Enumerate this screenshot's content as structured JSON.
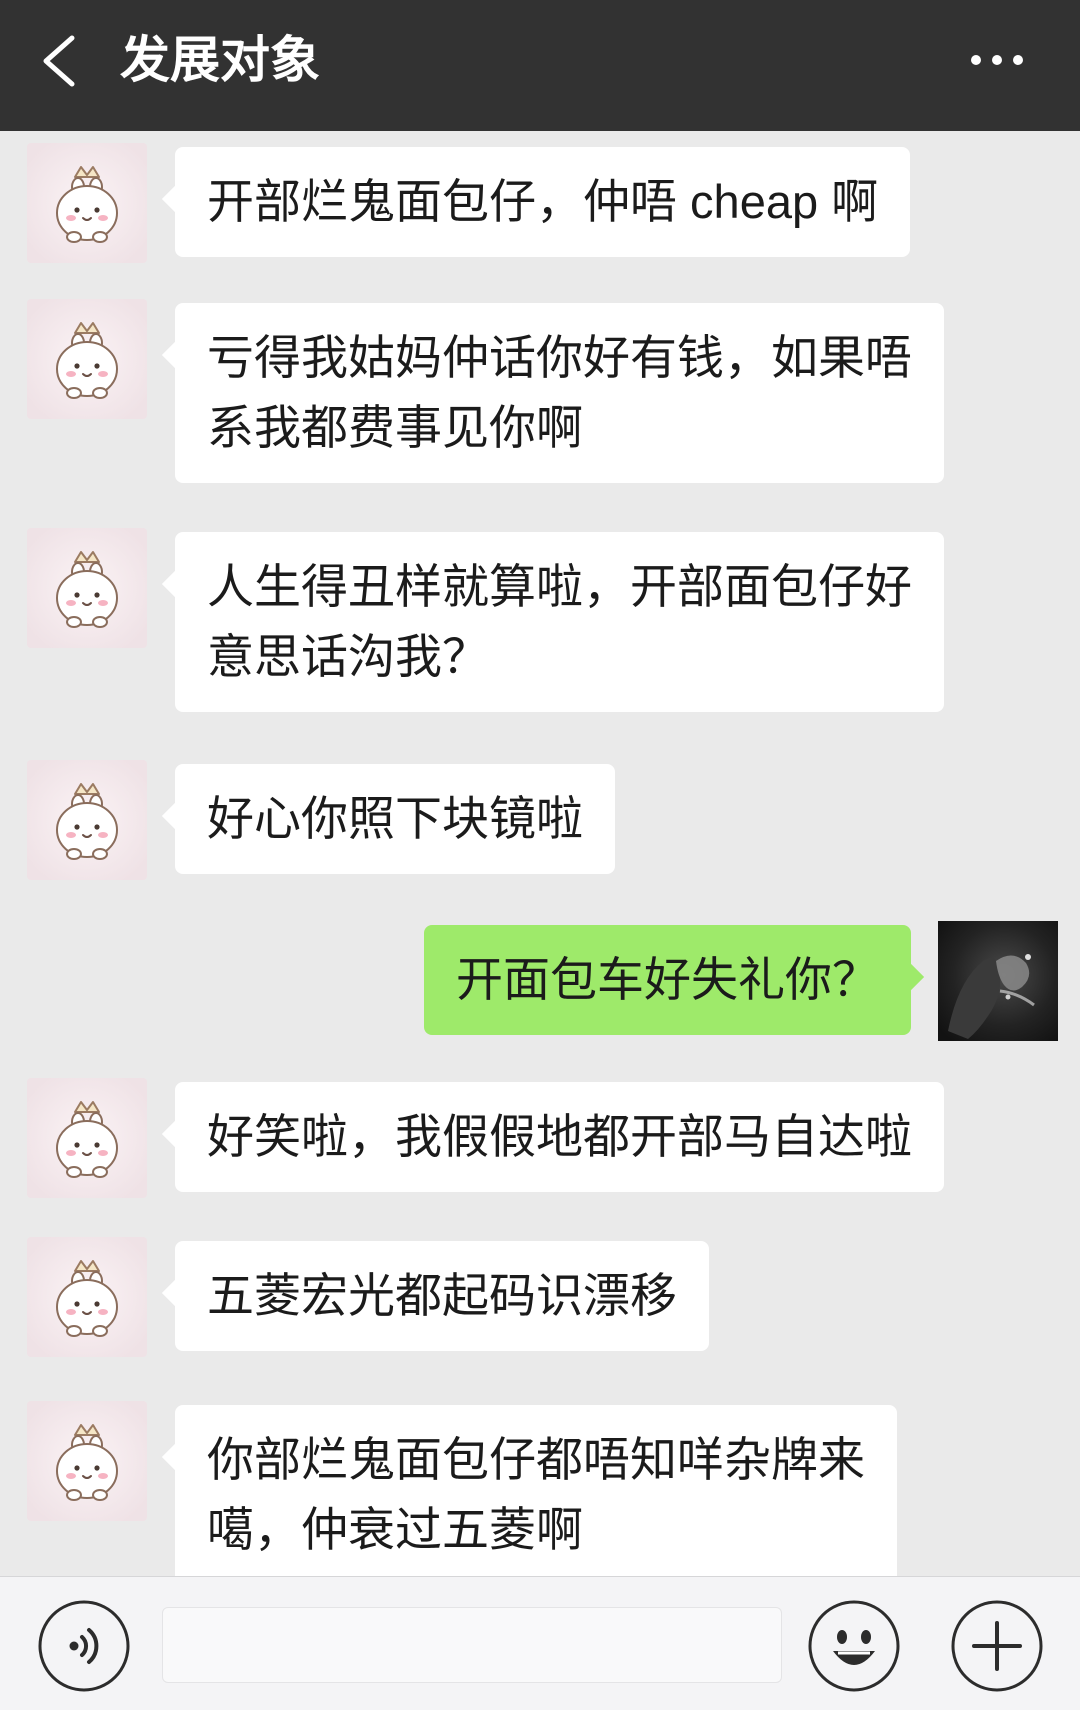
{
  "header": {
    "title": "发展对象",
    "back_icon": "chevron-left-icon",
    "more_icon": "more-horizontal-icon"
  },
  "colors": {
    "header_background": "#323232",
    "chat_background": "#eaeaea",
    "incoming_bubble": "#ffffff",
    "outgoing_bubble": "#9eea6a",
    "input_bar_background": "#f4f4f6"
  },
  "avatars": {
    "contact_icon": "bunny-avatar-icon",
    "self_icon": "photo-avatar-icon"
  },
  "messages": [
    {
      "outgoing": false,
      "lines": [
        "开部烂鬼面包仔，仲唔 cheap 啊"
      ]
    },
    {
      "outgoing": false,
      "lines": [
        "亏得我姑妈仲话你好有钱，如果唔",
        "系我都费事见你啊"
      ]
    },
    {
      "outgoing": false,
      "lines": [
        "人生得丑样就算啦，开部面包仔好",
        "意思话沟我？"
      ]
    },
    {
      "outgoing": false,
      "lines": [
        "好心你照下块镜啦"
      ]
    },
    {
      "outgoing": true,
      "lines": [
        "开面包车好失礼你？"
      ]
    },
    {
      "outgoing": false,
      "lines": [
        "好笑啦，我假假地都开部马自达啦"
      ]
    },
    {
      "outgoing": false,
      "lines": [
        "五菱宏光都起码识漂移"
      ]
    },
    {
      "outgoing": false,
      "lines": [
        "你部烂鬼面包仔都唔知咩杂牌来",
        "噶，仲衰过五菱啊"
      ]
    }
  ],
  "input_bar": {
    "voice_icon": "voice-icon",
    "input_value": "",
    "emoji_icon": "emoji-icon",
    "plus_icon": "plus-icon"
  }
}
